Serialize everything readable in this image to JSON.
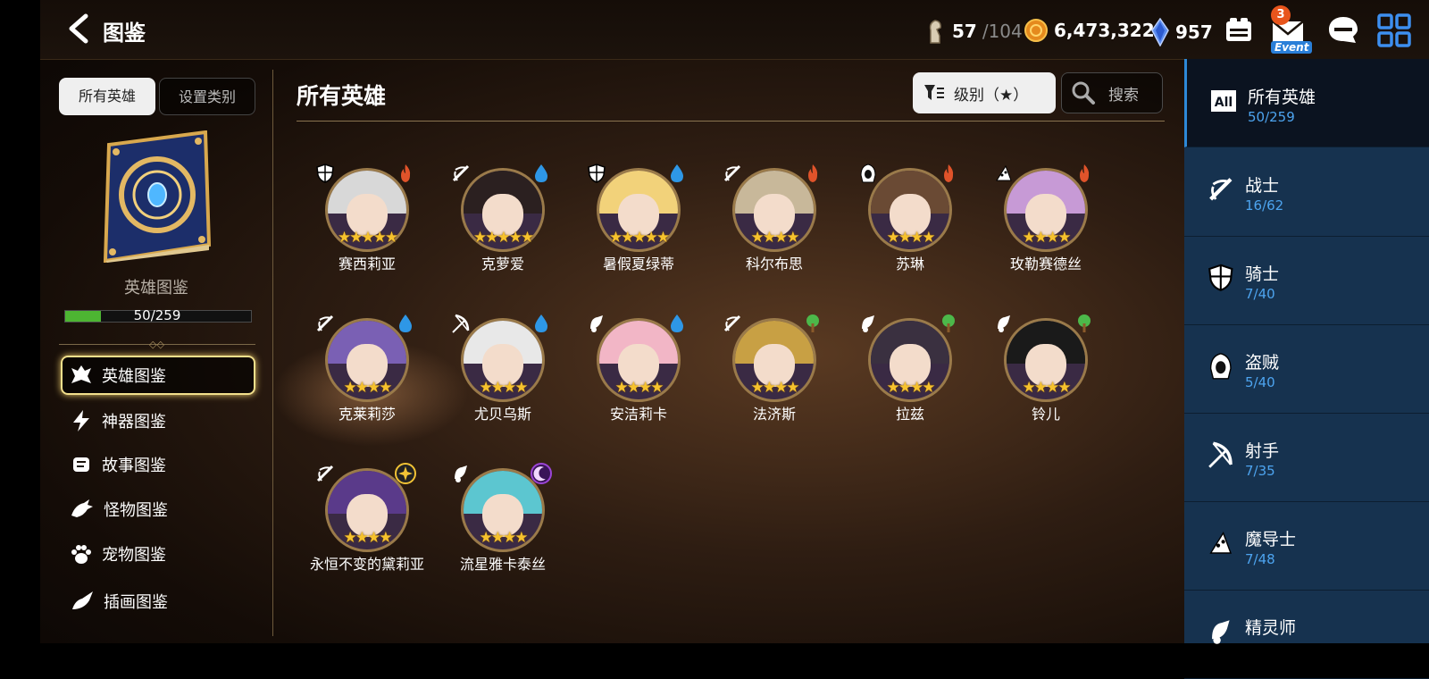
{
  "header": {
    "title": "图鉴",
    "stamina_current": "57",
    "stamina_max": "/104",
    "gold": "6,473,322",
    "crystals": "957",
    "mail_badge": "3",
    "event_label": "Event"
  },
  "left_panel": {
    "tabs": [
      {
        "label": "所有英雄"
      },
      {
        "label": "设置类别"
      }
    ],
    "book_label": "英雄图鉴",
    "progress_text": "50/259",
    "progress_fraction": 0.193,
    "menu": [
      {
        "label": "英雄图鉴",
        "icon": "hero-codex-icon",
        "active": true
      },
      {
        "label": "神器图鉴",
        "icon": "lightning-icon"
      },
      {
        "label": "故事图鉴",
        "icon": "scroll-icon"
      },
      {
        "label": "怪物图鉴",
        "icon": "dragon-icon"
      },
      {
        "label": "宠物图鉴",
        "icon": "paw-icon"
      },
      {
        "label": "插画图鉴",
        "icon": "brush-icon"
      }
    ]
  },
  "main": {
    "section_title": "所有英雄",
    "sort_label": "级别（★）",
    "search_label": "搜索",
    "heroes": [
      {
        "name": "赛西莉亚",
        "stars": "★★★★★",
        "class": "knight",
        "element": "fire"
      },
      {
        "name": "克萝爱",
        "stars": "★★★★★",
        "class": "warrior",
        "element": "water"
      },
      {
        "name": "暑假夏绿蒂",
        "stars": "★★★★★",
        "class": "knight",
        "element": "water"
      },
      {
        "name": "科尔布思",
        "stars": "★★★★",
        "class": "warrior",
        "element": "fire"
      },
      {
        "name": "苏琳",
        "stars": "★★★★",
        "class": "thief",
        "element": "fire"
      },
      {
        "name": "玫勒赛德丝",
        "stars": "★★★★",
        "class": "mage",
        "element": "fire"
      },
      {
        "name": "克莱莉莎",
        "stars": "★★★★",
        "class": "warrior",
        "element": "water"
      },
      {
        "name": "尤贝乌斯",
        "stars": "★★★★",
        "class": "archer",
        "element": "water"
      },
      {
        "name": "安洁莉卡",
        "stars": "★★★★",
        "class": "priest",
        "element": "water"
      },
      {
        "name": "法济斯",
        "stars": "★★★★",
        "class": "warrior",
        "element": "earth"
      },
      {
        "name": "拉兹",
        "stars": "★★★★",
        "class": "priest",
        "element": "earth"
      },
      {
        "name": "铃儿",
        "stars": "★★★★",
        "class": "priest",
        "element": "earth"
      },
      {
        "name": "永恒不变的黛莉亚",
        "stars": "★★★★",
        "class": "warrior",
        "element": "light"
      },
      {
        "name": "流星雅卡泰丝",
        "stars": "★★★★",
        "class": "priest",
        "element": "dark"
      }
    ]
  },
  "categories": [
    {
      "name": "所有英雄",
      "count": "50/259",
      "icon": "all-icon",
      "icon_text": "All",
      "active": true
    },
    {
      "name": "战士",
      "count": "16/62",
      "icon": "warrior-icon"
    },
    {
      "name": "骑士",
      "count": "7/40",
      "icon": "knight-shield-icon"
    },
    {
      "name": "盗贼",
      "count": "5/40",
      "icon": "thief-hood-icon"
    },
    {
      "name": "射手",
      "count": "7/35",
      "icon": "bow-icon"
    },
    {
      "name": "魔导士",
      "count": "7/48",
      "icon": "wizard-hat-icon"
    },
    {
      "name": "精灵师",
      "count": "",
      "icon": "spirit-icon"
    }
  ],
  "colors": {
    "fire": "#e0532a",
    "water": "#2e97e6",
    "earth": "#4cb84a",
    "light": "#f2c335",
    "dark": "#9b45d6",
    "accent_blue": "#4da4ef",
    "progress_green": "#4db532"
  }
}
